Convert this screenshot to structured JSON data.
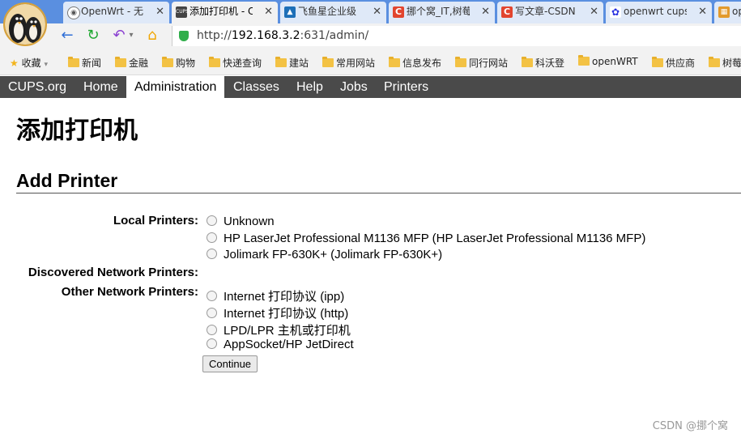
{
  "tabs": [
    {
      "label": "OpenWrt - 无",
      "favicon": "wifi-icon"
    },
    {
      "label": "添加打印机 - C",
      "favicon": "cups-icon",
      "active": true
    },
    {
      "label": "飞鱼星企业级",
      "favicon": "app-icon"
    },
    {
      "label": "挪个窝_IT,树莓",
      "favicon": "csdn-icon"
    },
    {
      "label": "写文章-CSDN",
      "favicon": "csdn-icon"
    },
    {
      "label": "openwrt cups",
      "favicon": "baidu-icon"
    },
    {
      "label": "op",
      "favicon": "app-icon"
    }
  ],
  "address": {
    "scheme": "http://",
    "host": "192.168.3.2",
    "path": ":631/admin/"
  },
  "bookmarks": {
    "favorites_label": "收藏",
    "items": [
      "新闻",
      "金融",
      "购物",
      "快递查询",
      "建站",
      "常用网站",
      "信息发布",
      "同行网站",
      "科沃登",
      "openWRT",
      "供应商",
      "树莓"
    ]
  },
  "cups_nav": [
    "CUPS.org",
    "Home",
    "Administration",
    "Classes",
    "Help",
    "Jobs",
    "Printers"
  ],
  "page_title": "添加打印机",
  "section_title": "Add Printer",
  "local_printers": {
    "label": "Local Printers:",
    "options": [
      "Unknown",
      "HP LaserJet Professional M1136 MFP (HP LaserJet Professional M1136 MFP)",
      "Jolimark FP-630K+ (Jolimark FP-630K+)"
    ]
  },
  "discovered_label": "Discovered Network Printers:",
  "other_network": {
    "label": "Other Network Printers:",
    "options": [
      "Internet 打印协议 (ipp)",
      "Internet 打印协议 (http)",
      "LPD/LPR 主机或打印机",
      "AppSocket/HP JetDirect"
    ]
  },
  "continue_label": "Continue",
  "watermark": "CSDN @挪个窝",
  "colors": {
    "tabbar": "#5a8fe0",
    "cups_nav": "#4a4a4a",
    "folder": "#f3c244"
  }
}
